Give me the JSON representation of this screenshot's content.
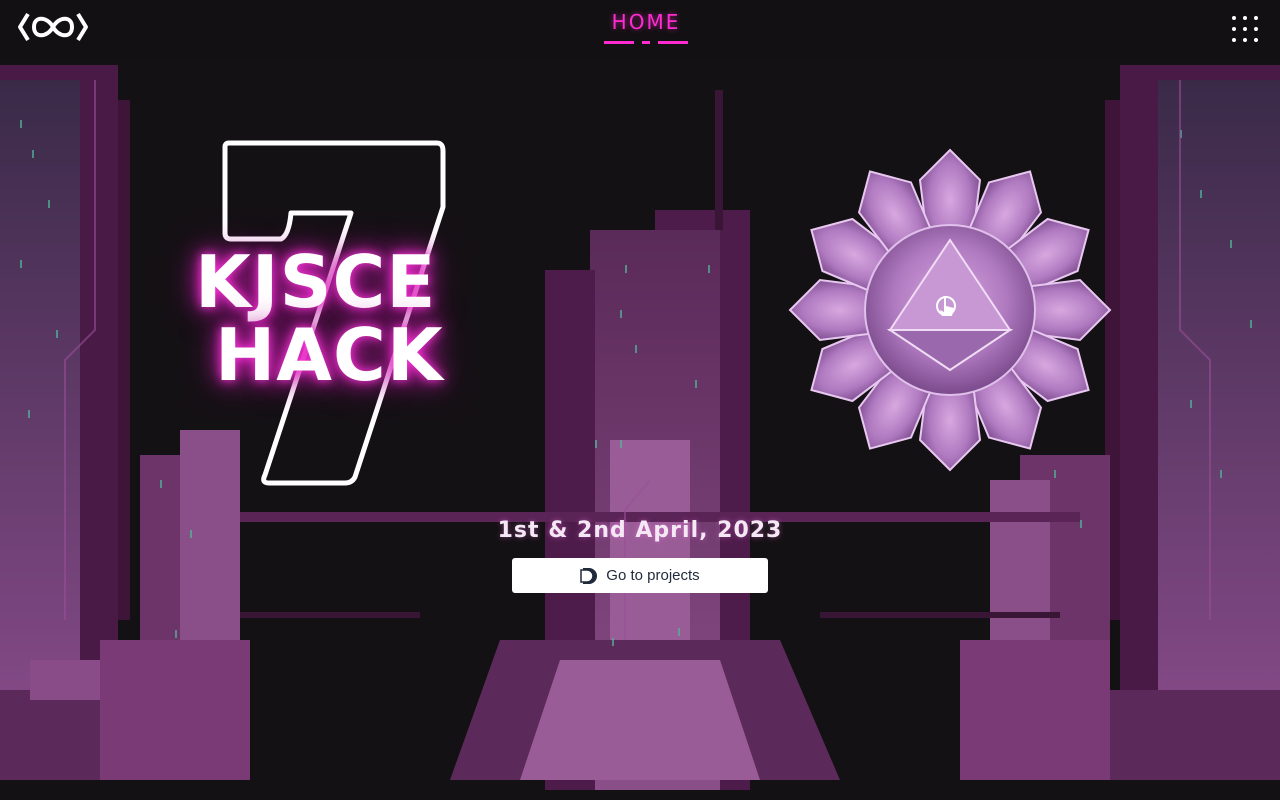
{
  "nav": {
    "logo_icon": "infinity-logo-icon",
    "active_item": "HOME",
    "menu_icon": "grid-dots-icon",
    "accent_color": "#ff2bd1"
  },
  "hero": {
    "number": "7",
    "title_line1": "KJSCE",
    "title_line2": "HACK",
    "glow_color": "#ff36dc"
  },
  "event": {
    "date": "1st & 2nd April, 2023"
  },
  "cta": {
    "label": "Go to projects",
    "icon": "devfolio-icon"
  },
  "orb": {
    "icon": "crystal-sphere-3d",
    "cursor": "hand-pointer-icon"
  },
  "theme": {
    "background": "#121012",
    "building_dark": "#4a1844",
    "building_mid": "#7a3a78",
    "building_light": "#a060a0"
  }
}
